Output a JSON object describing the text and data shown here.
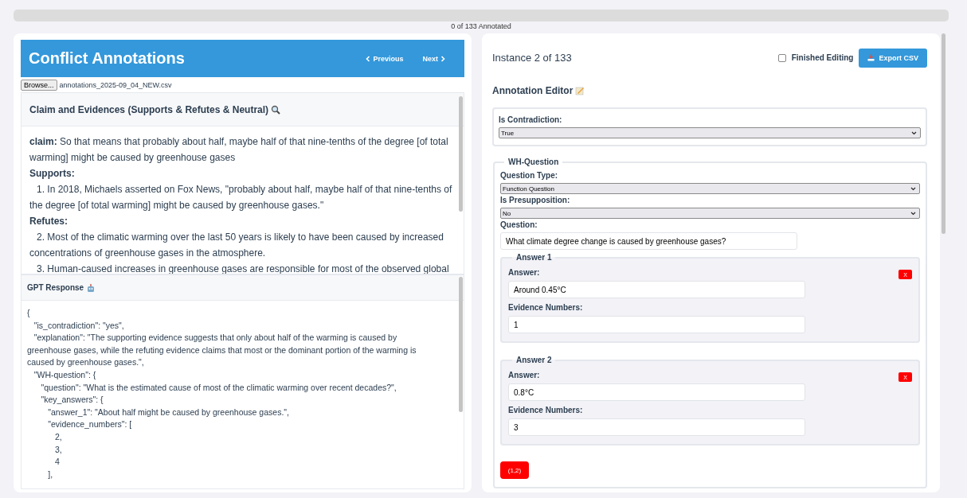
{
  "progress": {
    "level": 0,
    "label": "0 of 133 Annotated"
  },
  "header": {
    "title": "Conflict Annotations",
    "previous": "Previous",
    "next": "Next"
  },
  "file": {
    "button": "Browse...",
    "name": "annotations_2025-09_04_NEW.csv"
  },
  "claim_panel": {
    "title": "Claim and Evidences (Supports & Refutes & Neutral)",
    "blocks": [
      {
        "kind": "claim",
        "text": "**claim:** So that means that probably about half, maybe half of that nine-tenths of the degree [of total warming] might be caused by greenhouse gases"
      },
      {
        "kind": "heading",
        "text": "Supports:"
      },
      {
        "kind": "item",
        "text": "1. In 2018, Michaels asserted on Fox News, \"probably about half, maybe half of that nine-tenths of the degree [of total warming] might be caused by greenhouse gases.\""
      },
      {
        "kind": "heading",
        "text": "Refutes:"
      },
      {
        "kind": "item",
        "text": "2. Most of the climatic warming over the last 50 years is likely to have been caused by increased concentrations of greenhouse gases in the atmosphere."
      },
      {
        "kind": "item",
        "text": "3. Human-caused increases in greenhouse gases are responsible for most of the observed global"
      }
    ]
  },
  "gpt_panel": {
    "title": "GPT Response",
    "body": "{\n   \"is_contradiction\": \"yes\",\n   \"explanation\": \"The supporting evidence suggests that only about half of the warming is caused by greenhouse gases, while the refuting evidence claims that most or the dominant portion of the warming is caused by greenhouse gases.\",\n   \"WH-question\": {\n      \"question\": \"What is the estimated cause of most of the climatic warming over recent decades?\",\n      \"key_answers\": {\n         \"answer_1\": \"About half might be caused by greenhouse gases.\",\n         \"evidence_numbers\": [\n            2,\n            3,\n            4\n         ],"
  },
  "editor": {
    "instance": "Instance 2 of 133",
    "finished": {
      "label": "Finished Editing",
      "checked": false
    },
    "export": "Export CSV",
    "title": "Annotation Editor",
    "contradiction": {
      "label": "Is Contradiction:",
      "value": "True"
    },
    "wh": {
      "legend": "WH-Question",
      "question_type": {
        "label": "Question Type:",
        "value": "Function Question"
      },
      "presupposition": {
        "label": "Is Presupposition:",
        "value": "No"
      },
      "question": {
        "label": "Question:",
        "value": "What climate degree change is caused by greenhouse gases?"
      },
      "answers": [
        {
          "legend": "Answer 1",
          "answer_label": "Answer:",
          "answer": "Around 0.45°C",
          "evidence_label": "Evidence Numbers:",
          "evidence": "1",
          "remove": "X"
        },
        {
          "legend": "Answer 2",
          "answer_label": "Answer:",
          "answer": "0.8°C",
          "evidence_label": "Evidence Numbers:",
          "evidence": "3",
          "remove": "X"
        }
      ],
      "pair_button": "(1,2)"
    }
  }
}
